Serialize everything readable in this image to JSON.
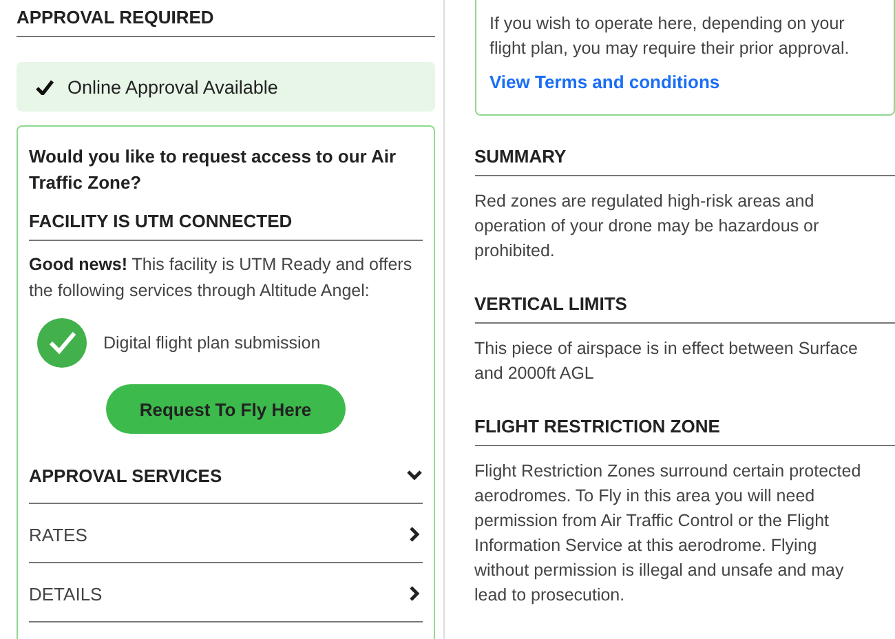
{
  "left": {
    "heading": "APPROVAL REQUIRED",
    "status": {
      "label": "Online Approval Available"
    },
    "card": {
      "question": "Would you like to request access to our Air Traffic Zone?",
      "facility_heading": "FACILITY IS UTM CONNECTED",
      "intro": "**Good news!** This facility is UTM Ready and offers the following services through Altitude Angel:",
      "services": [
        {
          "label": "Digital flight plan submission"
        }
      ],
      "button": "Request To Fly Here",
      "sections": [
        {
          "label": "APPROVAL SERVICES",
          "expanded": true
        },
        {
          "label": "RATES",
          "expanded": false
        },
        {
          "label": "DETAILS",
          "expanded": false
        }
      ]
    }
  },
  "right": {
    "card": {
      "text": "If you wish to operate here, depending on your flight plan, you may require their prior approval.",
      "link": "View Terms and conditions"
    },
    "sections": [
      {
        "heading": "SUMMARY",
        "text": "Red zones are regulated high-risk areas and operation of your drone may be hazardous or prohibited."
      },
      {
        "heading": "VERTICAL LIMITS",
        "text": "This piece of airspace is in effect between Surface and 2000ft AGL"
      },
      {
        "heading": "FLIGHT RESTRICTION ZONE",
        "text": "Flight Restriction Zones surround certain protected aerodromes. To Fly in this area you will need permission from Air Traffic Control or the Flight Information Service at this aerodrome. Flying without permission is illegal and unsafe and may lead to prosecution."
      }
    ]
  }
}
